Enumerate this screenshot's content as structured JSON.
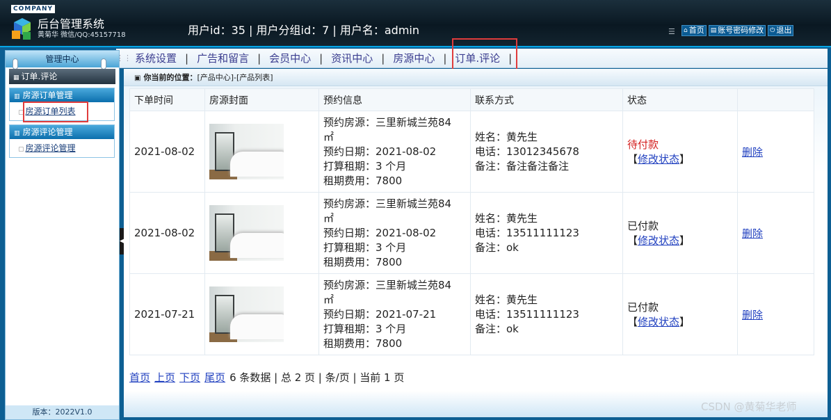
{
  "header": {
    "company": "COMPANY",
    "title": "后台管理系统",
    "subtitle": "黄菊华 微信/QQ:45157718",
    "user_info": "用户id：35 | 用户分组id：7 | 用户名：admin",
    "buttons": {
      "home": "首页",
      "password": "账号密码修改",
      "logout": "退出"
    }
  },
  "sidebar": {
    "header": "管理中心",
    "current": "订单.评论",
    "groups": [
      {
        "title": "房源订单管理",
        "items": [
          "房源订单列表"
        ]
      },
      {
        "title": "房源评论管理",
        "items": [
          "房源评论管理"
        ]
      }
    ],
    "version": "版本：2022V1.0"
  },
  "nav": [
    "系统设置",
    "广告和留言",
    "会员中心",
    "资讯中心",
    "房源中心",
    "订单.评论"
  ],
  "breadcrumb": {
    "label": "你当前的位置：",
    "path": "[产品中心]-[产品列表]"
  },
  "table": {
    "headers": [
      "下单时间",
      "房源封面",
      "预约信息",
      "联系方式",
      "状态",
      ""
    ],
    "rows": [
      {
        "date": "2021-08-02",
        "info": [
          "预约房源：三里新城兰苑84",
          "㎡",
          "预约日期：2021-08-02",
          "打算租期：3 个月",
          "租期费用：7800"
        ],
        "contact": [
          "姓名：黄先生",
          "电话：13012345678",
          "备注：备注备注备注"
        ],
        "status": "待付款",
        "modify": "修改状态",
        "action": "删除"
      },
      {
        "date": "2021-08-02",
        "info": [
          "预约房源：三里新城兰苑84",
          "㎡",
          "预约日期：2021-08-02",
          "打算租期：3 个月",
          "租期费用：7800"
        ],
        "contact": [
          "姓名：黄先生",
          "电话：13511111123",
          "备注：ok"
        ],
        "status": "已付款",
        "modify": "修改状态",
        "action": "删除"
      },
      {
        "date": "2021-07-21",
        "info": [
          "预约房源：三里新城兰苑84",
          "㎡",
          "预约日期：2021-07-21",
          "打算租期：3 个月",
          "租期费用：7800"
        ],
        "contact": [
          "姓名：黄先生",
          "电话：13511111123",
          "备注：ok"
        ],
        "status": "已付款",
        "modify": "修改状态",
        "action": "删除"
      }
    ]
  },
  "pager": {
    "first": "首页",
    "prev": "上页",
    "next": "下页",
    "last": "尾页",
    "summary": "6 条数据 | 总 2 页 | 条/页 | 当前 1 页"
  },
  "watermark": "CSDN @黄菊华老师",
  "colors": {
    "accent": "#0d5f93",
    "highlight": "#e03c3c",
    "unpaid": "#d42020"
  }
}
